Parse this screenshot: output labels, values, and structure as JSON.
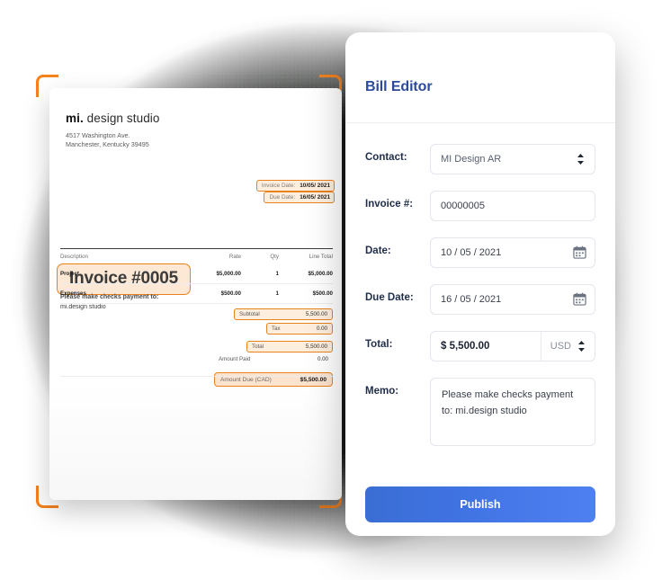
{
  "invoice": {
    "brand_bold": "mi.",
    "brand_rest": " design studio",
    "address_line1": "4517 Washington Ave.",
    "address_line2": "Manchester, Kentucky 39495",
    "badge": "Invoice #0005",
    "pay_note_line1": "Please make checks payment to:",
    "pay_note_line2": "mi.design studio",
    "invoice_date_label": "Invoice Date:",
    "invoice_date_value": "10/05/ 2021",
    "due_date_label": "Due Date:",
    "due_date_value": "16/05/ 2021",
    "table": {
      "headers": [
        "Description",
        "Rate",
        "Qty",
        "Line Total"
      ],
      "rows": [
        {
          "description": "Project",
          "rate": "$5,000.00",
          "qty": "1",
          "line_total": "$5,000.00"
        },
        {
          "description": "Expenses",
          "rate": "$500.00",
          "qty": "1",
          "line_total": "$500.00"
        }
      ]
    },
    "totals": {
      "subtotal_label": "Subtotal",
      "subtotal_value": "5,500.00",
      "tax_label": "Tax",
      "tax_value": "0.00",
      "total_label": "Total",
      "total_value": "5,500.00",
      "amount_paid_label": "Amount Paid",
      "amount_paid_value": "0.00",
      "amount_due_label": "Amount Due (CAD)",
      "amount_due_value": "$5,500.00"
    },
    "accent_color": "#e8821e",
    "highlight_bg": "#fdeedd"
  },
  "bill_editor": {
    "title": "Bill Editor",
    "title_color": "#2b4a9c",
    "fields": {
      "contact_label": "Contact:",
      "contact_value": "MI Design AR",
      "invoice_no_label": "Invoice #:",
      "invoice_no_value": "00000005",
      "date_label": "Date:",
      "date_value": "10 / 05 / 2021",
      "due_date_label": "Due Date:",
      "due_date_value": "16 / 05 / 2021",
      "total_label": "Total:",
      "total_value": "$ 5,500.00",
      "currency_value": "USD",
      "memo_label": "Memo:",
      "memo_value": "Please make checks payment to:  mi.design studio"
    },
    "publish_label": "Publish",
    "publish_color": "#4073e2"
  }
}
